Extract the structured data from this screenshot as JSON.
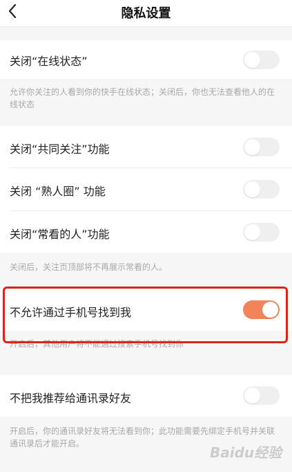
{
  "header": {
    "title": "隐私设置",
    "back_icon": "chevron-left-icon"
  },
  "settings": {
    "online_status": {
      "label": "关闭“在线状态”",
      "enabled": false,
      "description": "允许你关注的人看到你的快手在线状态；关闭后，你也无法查看他人的在线状态"
    },
    "mutual_follow": {
      "label": "关闭“共同关注”功能",
      "enabled": false
    },
    "acquaintance_circle": {
      "label": "关闭 “熟人圈” 功能",
      "enabled": false
    },
    "frequent_viewers": {
      "label": "关闭“常看的人”功能",
      "enabled": false,
      "description": "关闭后，关注页顶部将不再展示常看的人。"
    },
    "find_by_phone": {
      "label": "不允许通过手机号找到我",
      "enabled": true,
      "description": "开启后，其他用户将不能通过搜索手机号找到你"
    },
    "recommend_contacts": {
      "label": "不把我推荐给通讯录好友",
      "enabled": false,
      "description": "开启后，你的通讯录好友将无法看到你；此功能需要先绑定手机号并关联通讯录后才能开启。"
    }
  },
  "colors": {
    "accent": "#f1845b",
    "highlight": "#e0221c",
    "toggle_off": "#efefef"
  },
  "watermark": "Baidu经验"
}
